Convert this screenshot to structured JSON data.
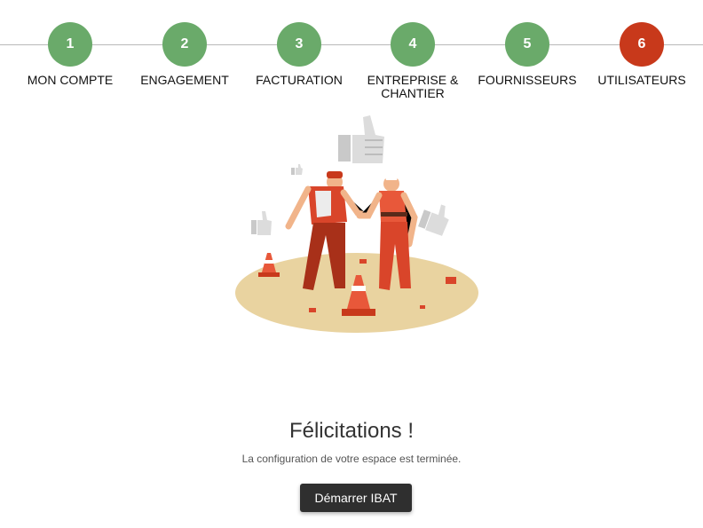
{
  "stepper": {
    "steps": [
      {
        "number": "1",
        "label": "MON COMPTE",
        "status": "done"
      },
      {
        "number": "2",
        "label": "ENGAGEMENT",
        "status": "done"
      },
      {
        "number": "3",
        "label": "FACTURATION",
        "status": "done"
      },
      {
        "number": "4",
        "label": "ENTREPRISE &\nCHANTIER",
        "status": "done"
      },
      {
        "number": "5",
        "label": "FOURNISSEURS",
        "status": "done"
      },
      {
        "number": "6",
        "label": "UTILISATEURS",
        "status": "current"
      }
    ],
    "colors": {
      "done": "#6aaa6a",
      "current": "#c8391b"
    }
  },
  "main": {
    "title": "Félicitations !",
    "subtitle": "La configuration de votre espace est terminée.",
    "start_button": "Démarrer IBAT"
  },
  "illustration": {
    "icon": "construction-workers-handshake-illustration"
  }
}
